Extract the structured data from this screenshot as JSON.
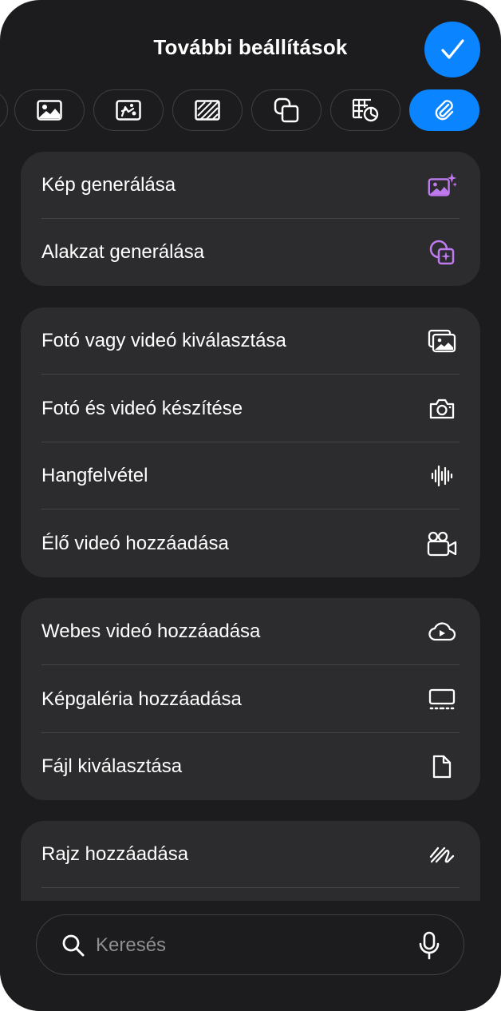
{
  "header": {
    "title": "További beállítások",
    "done_icon": "checkmark-icon"
  },
  "tabs": [
    {
      "icon": "tab-partial-icon",
      "active": false
    },
    {
      "icon": "image-icon",
      "active": false
    },
    {
      "icon": "media-chart-icon",
      "active": false
    },
    {
      "icon": "hatched-rectangle-icon",
      "active": false
    },
    {
      "icon": "overlapping-squares-icon",
      "active": false
    },
    {
      "icon": "table-chart-icon",
      "active": false
    },
    {
      "icon": "paperclip-icon",
      "active": true
    }
  ],
  "groups": [
    {
      "items": [
        {
          "label": "Kép generálása",
          "icon": "sparkle-image-icon"
        },
        {
          "label": "Alakzat generálása",
          "icon": "sparkle-shape-icon"
        }
      ]
    },
    {
      "items": [
        {
          "label": "Fotó vagy videó kiválasztása",
          "icon": "photo-library-icon"
        },
        {
          "label": "Fotó és videó készítése",
          "icon": "camera-icon"
        },
        {
          "label": "Hangfelvétel",
          "icon": "waveform-icon"
        },
        {
          "label": "Élő videó hozzáadása",
          "icon": "video-camera-icon"
        }
      ]
    },
    {
      "items": [
        {
          "label": "Webes videó hozzáadása",
          "icon": "cloud-play-icon"
        },
        {
          "label": "Képgaléria hozzáadása",
          "icon": "gallery-icon"
        },
        {
          "label": "Fájl kiválasztása",
          "icon": "document-icon"
        }
      ]
    },
    {
      "items": [
        {
          "label": "Rajz hozzáadása",
          "icon": "scribble-icon"
        }
      ]
    }
  ],
  "search": {
    "placeholder": "Keresés",
    "icon": "search-icon",
    "mic_icon": "microphone-icon"
  },
  "colors": {
    "background": "#1c1c1e",
    "card": "#2c2c2e",
    "accent": "#0a84ff",
    "purple": "#bf7af0"
  }
}
